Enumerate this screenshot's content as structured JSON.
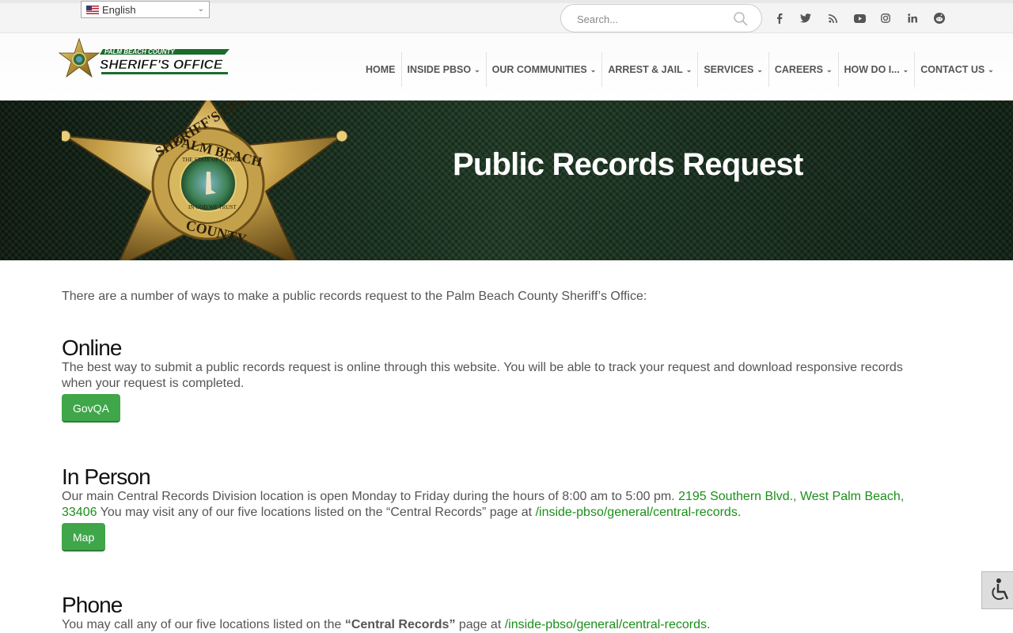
{
  "topbar": {
    "language": "English",
    "search_placeholder": "Search...",
    "social": [
      {
        "icon": "facebook-icon",
        "glyph": "f"
      },
      {
        "icon": "twitter-icon",
        "glyph": "t"
      },
      {
        "icon": "rss-icon",
        "glyph": "rss"
      },
      {
        "icon": "youtube-icon",
        "glyph": "yt"
      },
      {
        "icon": "instagram-icon",
        "glyph": "ig"
      },
      {
        "icon": "linkedin-icon",
        "glyph": "in"
      },
      {
        "icon": "reddit-icon",
        "glyph": "rd"
      }
    ]
  },
  "logo": {
    "line1": "PALM BEACH COUNTY",
    "line2": "SHERIFF'S OFFICE"
  },
  "nav": {
    "items": [
      {
        "label": "HOME",
        "dropdown": false
      },
      {
        "label": "INSIDE PBSO",
        "dropdown": true
      },
      {
        "label": "OUR COMMUNITIES",
        "dropdown": true
      },
      {
        "label": "ARREST & JAIL",
        "dropdown": true
      },
      {
        "label": "SERVICES",
        "dropdown": true
      },
      {
        "label": "CAREERS",
        "dropdown": true
      },
      {
        "label": "HOW DO I...",
        "dropdown": true
      },
      {
        "label": "CONTACT US",
        "dropdown": true
      }
    ]
  },
  "hero": {
    "title": "Public Records Request",
    "badge_text_top": "SHERIFF'S OFFICE",
    "badge_text_mid": "PALM BEACH",
    "badge_text_bottom": "COUNTY",
    "badge_seal": "THE STATE OF FLORIDA",
    "badge_motto": "IN GOD WE TRUST"
  },
  "content": {
    "intro": "There are a number of ways to make a public records request to the Palm Beach County Sheriff’s Office:",
    "online": {
      "heading": "Online",
      "text": "The best way to submit a public records request is online through this website. You will be able to track your request and download responsive records when your request is completed.",
      "button": "GovQA"
    },
    "in_person": {
      "heading": "In Person",
      "text_before": "Our main Central Records Division location is open Monday to Friday during the hours of 8:00 am to 5:00 pm. ",
      "address_link": "2195 Southern Blvd., West Palm Beach, 33406",
      "text_middle": " You may visit any of our five locations listed on the “Central Records” page at ",
      "page_link": "/inside-pbso/general/central-records",
      "text_after": ".",
      "button": "Map"
    },
    "phone": {
      "heading": "Phone",
      "text_before": "You may call any of our five locations listed on the ",
      "bold": "“Central Records”",
      "text_middle": " page at ",
      "page_link": "/inside-pbso/general/central-records",
      "text_after": "."
    }
  },
  "colors": {
    "accent_green": "#3fa64a",
    "link_green": "#1a8f1a",
    "hero_dark": "#1a2a1c"
  }
}
